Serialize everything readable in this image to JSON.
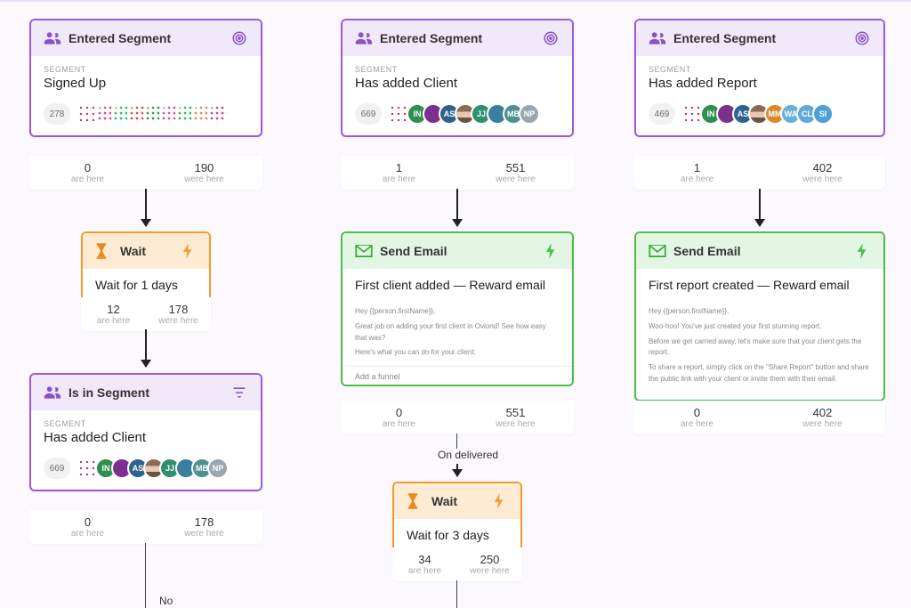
{
  "labels": {
    "segment": "SEGMENT",
    "are_here": "are here",
    "were_here": "were here",
    "on_delivered": "On delivered",
    "no": "No",
    "add_funnel": "Add a funnel"
  },
  "colors": {
    "purple": "#9a5cd6",
    "orange": "#f29c2b",
    "green": "#4cbf4c"
  },
  "col1": {
    "entered": {
      "title": "Entered Segment",
      "segment": "Signed Up",
      "count": "278",
      "are_here": "0",
      "were_here": "190"
    },
    "wait": {
      "title": "Wait",
      "text": "Wait for 1 days",
      "are_here": "12",
      "were_here": "178"
    },
    "isin": {
      "title": "Is in Segment",
      "segment": "Has added Client",
      "count": "669",
      "are_here": "0",
      "were_here": "178",
      "avatars": [
        "IN",
        "",
        "AS",
        "",
        "JJ",
        "",
        "MB",
        "NP"
      ]
    }
  },
  "col2": {
    "entered": {
      "title": "Entered Segment",
      "segment": "Has added Client",
      "count": "669",
      "are_here": "1",
      "were_here": "551",
      "avatars": [
        "IN",
        "",
        "AS",
        "",
        "JJ",
        "",
        "MB",
        "NP"
      ]
    },
    "email": {
      "title": "Send Email",
      "subject": "First client added — Reward email",
      "preview": [
        "Hey {{person.firstName}},",
        "Great job on adding your first client in Oviond! See how easy that was?",
        "Here's what you can do for your client:"
      ],
      "are_here": "0",
      "were_here": "551"
    },
    "wait": {
      "title": "Wait",
      "text": "Wait for 3 days",
      "are_here": "34",
      "were_here": "250"
    }
  },
  "col3": {
    "entered": {
      "title": "Entered Segment",
      "segment": "Has added Report",
      "count": "469",
      "are_here": "1",
      "were_here": "402",
      "avatars": [
        "IN",
        "",
        "AS",
        "",
        "MM",
        "WA",
        "CL",
        "SI"
      ]
    },
    "email": {
      "title": "Send Email",
      "subject": "First report created — Reward email",
      "preview": [
        "Hey {{person.firstName}},",
        "Woo-hoo! You've just created your first stunning report.",
        "Before we get carried away, let's make sure that your client gets the report.",
        "To share a report, simply click on the \"Share Report\" button and share the public link with your client or invite them with their email."
      ],
      "are_here": "0",
      "were_here": "402"
    }
  },
  "avatar_colors": [
    "#2f8f4f",
    "#7d2f8f",
    "#2f638f",
    "#388f6b",
    "#2f8f6f",
    "#3b7f9f",
    "#4f8f8f",
    "#9aa7af"
  ],
  "avatar_colors_col3": [
    "#2f8f4f",
    "#7d2f8f",
    "#2f638f",
    "#d94f4f",
    "#d98a2f",
    "#69b0d9",
    "#5fa8d9",
    "#4f9fd9"
  ]
}
